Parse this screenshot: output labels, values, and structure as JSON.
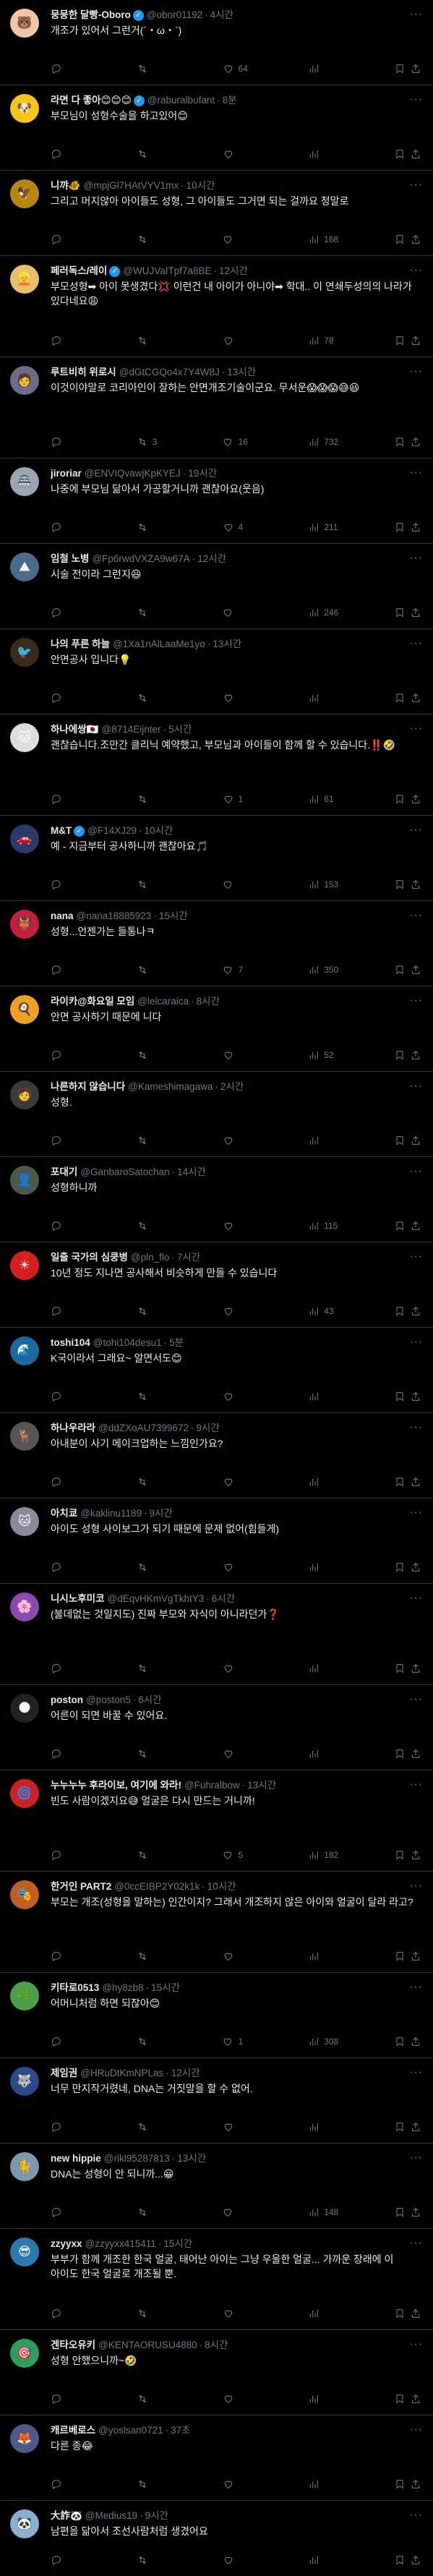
{
  "replies": [
    {
      "name": "뭉뭉한 달빵-Oboro",
      "verified": true,
      "handle": "@obor01192",
      "time": "4시간",
      "text": "개조가 있어서 그런거(´・ω・`)",
      "replies": "",
      "reposts": "",
      "likes": "64",
      "views": "",
      "color": "#f2c6a0",
      "avatar": "🐻"
    },
    {
      "name": "라면 다 좋아😊😊😊",
      "verified": true,
      "handle": "@raburalbufant",
      "time": "8분",
      "text": "부모님이 성형수술을 하고있어😊",
      "replies": "",
      "reposts": "",
      "likes": "",
      "views": "",
      "color": "#f5c518",
      "avatar": "🐶"
    },
    {
      "name": "니꺄🐠",
      "verified": false,
      "handle": "@mpjGl7HAtVYV1mx",
      "time": "10시간",
      "text": "그리고 머지않아 아이들도 성형, 그 아이들도 그거면 되는 걸까요 정말로",
      "replies": "",
      "reposts": "",
      "likes": "",
      "views": "168",
      "color": "#b8860b",
      "avatar": "🦅"
    },
    {
      "name": "페러독스/레이",
      "verified": true,
      "handle": "@WUJVaITpf7a8BE",
      "time": "12시간",
      "text": "부모성형➡ 아이 못생겼다💢 이런건 내 아이가 아니야➡ 학대.. 이 연쇄두성의의 나라가 있다네요😩",
      "replies": "",
      "reposts": "",
      "likes": "",
      "views": "78",
      "color": "#e8c06a",
      "avatar": "👱"
    },
    {
      "name": "루트비히 위로시",
      "verified": false,
      "handle": "@dGtCGQo4x7Y4W8J",
      "time": "13시간",
      "text": "이것이야말로 코리아인이 잘하는 안면개조기술이군요. 무서운😱😱😱😅😆",
      "replies": "",
      "reposts": "3",
      "likes": "16",
      "views": "732",
      "color": "#6b6b8a",
      "avatar": "🧑"
    },
    {
      "name": "jiroriar",
      "verified": false,
      "handle": "@ENVIQvawjKpKYEJ",
      "time": "19시간",
      "text": "나중에 부모님 닮아서 가공할거니까 괜찮아요(웃음)",
      "replies": "",
      "reposts": "",
      "likes": "4",
      "views": "211",
      "color": "#9aa6b2",
      "avatar": "🏯"
    },
    {
      "name": "임철 노병",
      "verified": false,
      "handle": "@Fp6rwdVXZA9w67A",
      "time": "12시간",
      "text": "시술 전이라 그런지😆",
      "replies": "",
      "reposts": "",
      "likes": "",
      "views": "246",
      "color": "#4a6a8a",
      "avatar": "⛰"
    },
    {
      "name": "나의 푸른 하늘",
      "verified": false,
      "handle": "@1Xa1nAlLaaMe1yo",
      "time": "13시간",
      "text": "안면공사 입니다💡",
      "replies": "",
      "reposts": "",
      "likes": "",
      "views": "",
      "color": "#3a2a1a",
      "avatar": "🐦"
    },
    {
      "name": "하나에쌍🇯🇵",
      "verified": false,
      "handle": "@8714Eijnter",
      "time": "5시간",
      "text": "괜찮습니다.조만간 클리닉 예약했고, 부모님과 아이들이 함께 할 수 있습니다.‼️🤣",
      "replies": "",
      "reposts": "",
      "likes": "1",
      "views": "61",
      "color": "#ddd",
      "avatar": "🐱"
    },
    {
      "name": "M&T",
      "verified": true,
      "handle": "@F14XJ29",
      "time": "10시간",
      "text": "예 - 지금부터 공사하니까 괜찮아요🎵",
      "replies": "",
      "reposts": "",
      "likes": "",
      "views": "153",
      "color": "#2a3a6a",
      "avatar": "🚗"
    },
    {
      "name": "nana",
      "verified": false,
      "handle": "@nana18885923",
      "time": "15시간",
      "text": "성형...언젠가는 들통나ㅋ",
      "replies": "",
      "reposts": "",
      "likes": "7",
      "views": "350",
      "color": "#c81e3c",
      "avatar": "👹"
    },
    {
      "name": "라이카@화요일 모임",
      "verified": false,
      "handle": "@lelcaraica",
      "time": "8시간",
      "text": "안면 공사하기 때문에 니다",
      "replies": "",
      "reposts": "",
      "likes": "",
      "views": "52",
      "color": "#f0a020",
      "avatar": "🍳"
    },
    {
      "name": "나른하지 않습니다",
      "verified": false,
      "handle": "@Kameshimagawa",
      "time": "2시간",
      "text": "성형.",
      "replies": "",
      "reposts": "",
      "likes": "",
      "views": "",
      "color": "#3a3a3a",
      "avatar": "🧑"
    },
    {
      "name": "포대기",
      "verified": false,
      "handle": "@GanbaroSatochan",
      "time": "14시간",
      "text": "성형하니까",
      "replies": "",
      "reposts": "",
      "likes": "",
      "views": "115",
      "color": "#4a5a4a",
      "avatar": "👤"
    },
    {
      "name": "일출 국가의 심쿵병",
      "verified": false,
      "handle": "@pln_flo",
      "time": "7시간",
      "text": "10년 정도 지나면 공사해서 비슷하게 만들 수 있습니다",
      "replies": "",
      "reposts": "",
      "likes": "",
      "views": "43",
      "color": "#d81e1e",
      "avatar": "☀"
    },
    {
      "name": "toshi104",
      "verified": false,
      "handle": "@tohi104desu1",
      "time": "5분",
      "text": "K국이라서 그래요~ 알면서도😊",
      "replies": "",
      "reposts": "",
      "likes": "",
      "views": "",
      "color": "#1a6aa0",
      "avatar": "🌊"
    },
    {
      "name": "하나우라라",
      "verified": false,
      "handle": "@ddZXoAU7399672",
      "time": "9시간",
      "text": "아내분이 사기 메이크업하는 느낌인가요?",
      "replies": "",
      "reposts": "",
      "likes": "",
      "views": "",
      "color": "#555",
      "avatar": "🦌"
    },
    {
      "name": "아치쿄",
      "verified": false,
      "handle": "@kaklinu1189",
      "time": "9시간",
      "text": "아이도 성형 사이보그가 되기 때문에 문제 없어(힘들게)",
      "replies": "",
      "reposts": "",
      "likes": "",
      "views": "",
      "color": "#8a8a9a",
      "avatar": "🐱"
    },
    {
      "name": "니시노후미코",
      "verified": false,
      "handle": "@dEqvHKmVgTkhtY3",
      "time": "6시간",
      "text": "(불데없는 것일지도) 진짜 부모와 자식이 아니라던가❓",
      "replies": "",
      "reposts": "",
      "likes": "",
      "views": "",
      "color": "#8a4ab0",
      "avatar": "🌸"
    },
    {
      "name": "poston",
      "verified": false,
      "handle": "@poston5",
      "time": "6시간",
      "text": "어른이 되면 바꿀 수 있어요.",
      "replies": "",
      "reposts": "",
      "likes": "",
      "views": "",
      "color": "#222",
      "avatar": "🌑"
    },
    {
      "name": "누누누누 후라이보, 여기에 와라!",
      "verified": false,
      "handle": "@Fuhralbow",
      "time": "13시간",
      "text": "빈도 사람이겠지요😅 얼굴은 다시 만드는 거니까!",
      "replies": "",
      "reposts": "",
      "likes": "5",
      "views": "182",
      "color": "#d02020",
      "avatar": "🌀"
    },
    {
      "name": "한거인 PART2",
      "verified": false,
      "handle": "@0ccEIBP2Y02k1k",
      "time": "10시간",
      "text": "부모는 개조(성형을 말하는) 인간이지? 그래서 개조하지 않은 아이와 얼굴이 달라 라고?",
      "replies": "",
      "reposts": "",
      "likes": "",
      "views": "",
      "color": "#c06020",
      "avatar": "🎭"
    },
    {
      "name": "키타로0513",
      "verified": false,
      "handle": "@hy8zb8",
      "time": "15시간",
      "text": "어머니처럼 하면 되잖아😊",
      "replies": "",
      "reposts": "",
      "likes": "1",
      "views": "308",
      "color": "#4aa04a",
      "avatar": "🌿"
    },
    {
      "name": "제임권",
      "verified": false,
      "handle": "@HRuDtKmNPLas",
      "time": "12시간",
      "text": "너무 만지작거렸네, DNA는 거짓말을 할 수 없어.",
      "replies": "",
      "reposts": "",
      "likes": "",
      "views": "",
      "color": "#2a4a8a",
      "avatar": "🐺"
    },
    {
      "name": "new hippie",
      "verified": false,
      "handle": "@rikl95287813",
      "time": "13시간",
      "text": "DNA는 성형이 안 되니까...😀",
      "replies": "",
      "reposts": "",
      "likes": "",
      "views": "148",
      "color": "#7a9ab0",
      "avatar": "🐈"
    },
    {
      "name": "zzyyxx",
      "verified": false,
      "handle": "@zzyyxx415411",
      "time": "15시간",
      "text": "부부가 함께 개조한 한국 얼굴, 태어난 아이는 그냥 우울한 얼굴... 가까운 장래에 이 아이도 한국 얼굴로 개조될 뿐.",
      "replies": "",
      "reposts": "",
      "likes": "",
      "views": "",
      "color": "#2a7ab0",
      "avatar": "😎"
    },
    {
      "name": "겐타오유키",
      "verified": false,
      "handle": "@KENTAORUSU4880",
      "time": "8시간",
      "text": "성형 안했으니까~🤣",
      "replies": "",
      "reposts": "",
      "likes": "",
      "views": "",
      "color": "#2aa060",
      "avatar": "🎯"
    },
    {
      "name": "캐르베로스",
      "verified": false,
      "handle": "@yoslsan0721",
      "time": "37초",
      "text": "다른 종😂",
      "replies": "",
      "reposts": "",
      "likes": "",
      "views": "",
      "color": "#4a5a8a",
      "avatar": "🦊"
    },
    {
      "name": "大詐🐼",
      "verified": false,
      "handle": "@Medius19",
      "time": "9시간",
      "text": "남편을 닮아서 조선사람처럼 생겼어요",
      "replies": "",
      "reposts": "",
      "likes": "",
      "views": "",
      "color": "#8ab0d0",
      "avatar": "🐼"
    }
  ]
}
